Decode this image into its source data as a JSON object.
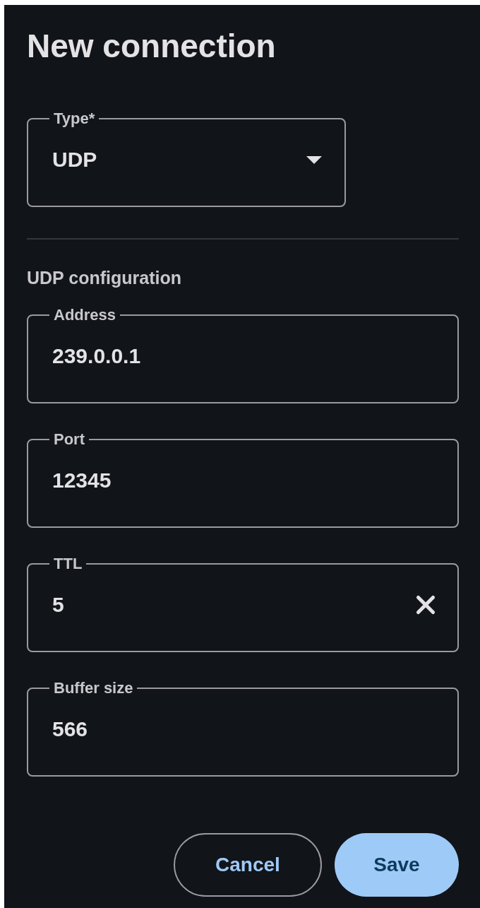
{
  "dialog": {
    "title": "New connection"
  },
  "type_field": {
    "label": "Type*",
    "value": "UDP",
    "kind": "select"
  },
  "section": {
    "title": "UDP configuration"
  },
  "fields": [
    {
      "label": "Address",
      "value": "239.0.0.1",
      "kind": "text",
      "clearable": false
    },
    {
      "label": "Port",
      "value": "12345",
      "kind": "text",
      "clearable": false
    },
    {
      "label": "TTL",
      "value": "5",
      "kind": "text",
      "clearable": true
    },
    {
      "label": "Buffer size",
      "value": "566",
      "kind": "text",
      "clearable": false
    }
  ],
  "buttons": [
    {
      "label": "Cancel",
      "kind": "outlined"
    },
    {
      "label": "Save",
      "kind": "filled"
    }
  ]
}
